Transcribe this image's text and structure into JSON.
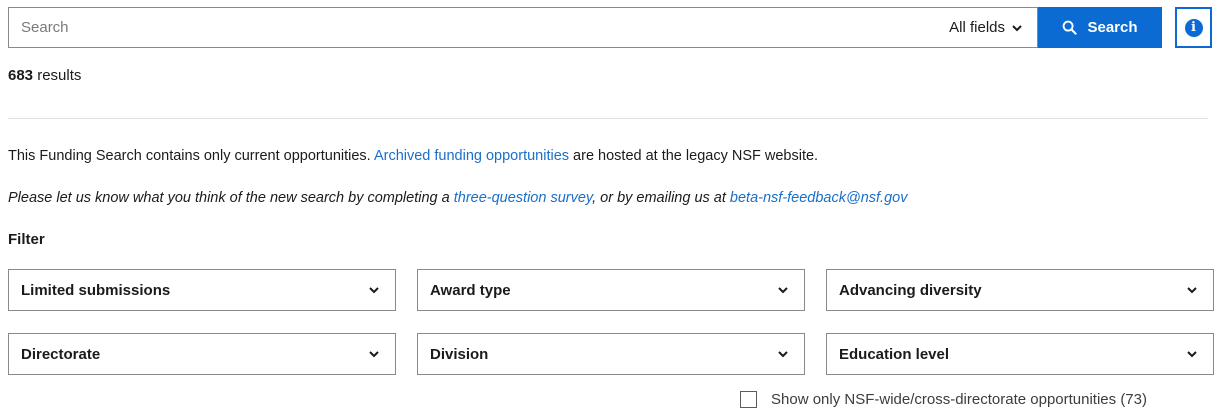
{
  "search": {
    "placeholder": "Search",
    "value": "",
    "field_selector": "All fields",
    "button_label": "Search"
  },
  "results": {
    "count": "683",
    "label": "results"
  },
  "notice": {
    "text_before": "This Funding Search contains only current opportunities.",
    "link_text": "Archived funding opportunities",
    "text_after": "are hosted at the legacy NSF website."
  },
  "feedback": {
    "text_before": "Please let us know what you think of the new search by completing a",
    "survey_link": "three-question survey",
    "text_middle": ", or by emailing us at",
    "email_link": "beta-nsf-feedback@nsf.gov"
  },
  "filter": {
    "heading": "Filter",
    "selects": [
      {
        "label": "Limited submissions"
      },
      {
        "label": "Award type"
      },
      {
        "label": "Advancing diversity"
      },
      {
        "label": "Directorate"
      },
      {
        "label": "Division"
      },
      {
        "label": "Education level"
      }
    ],
    "checkbox_label": "Show only NSF-wide/cross-directorate opportunities (73)",
    "checkbox_checked": false
  },
  "colors": {
    "accent": "#0b6bd3",
    "link": "#1a6fc9"
  }
}
